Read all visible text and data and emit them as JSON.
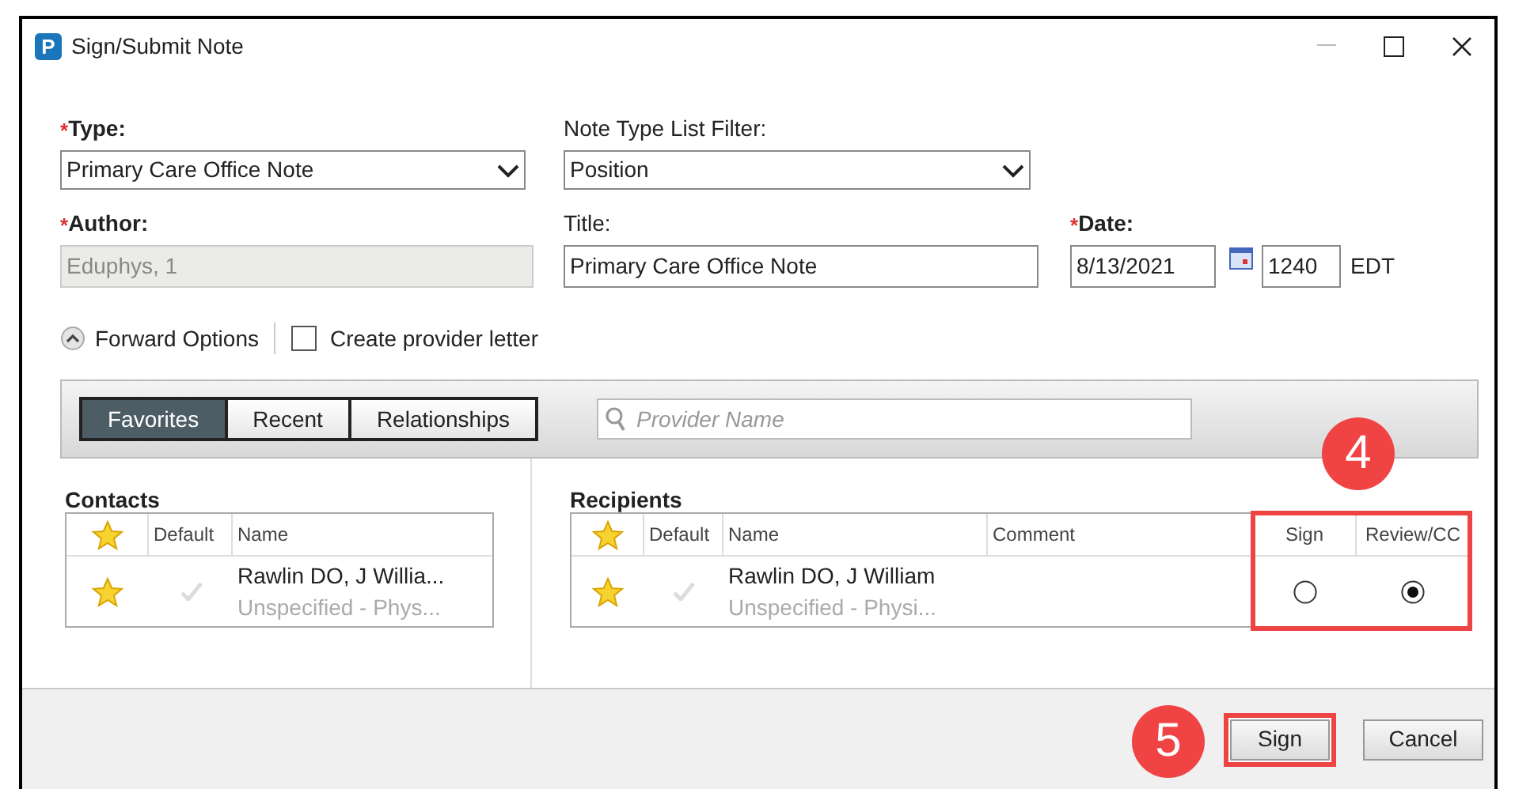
{
  "window": {
    "title": "Sign/Submit Note",
    "app_icon_letter": "P"
  },
  "type": {
    "required_mark": "*",
    "label": "Type:",
    "value": "Primary Care Office Note"
  },
  "note_type_list_filter": {
    "label": "Note Type List Filter:",
    "value": "Position"
  },
  "author": {
    "required_mark": "*",
    "label": "Author:",
    "value": "Eduphys, 1",
    "disabled": true
  },
  "title": {
    "label": "Title:",
    "value": "Primary Care Office Note"
  },
  "date": {
    "required_mark": "*",
    "label": "Date:",
    "value": "8/13/2021",
    "time": "1240",
    "zone": "EDT"
  },
  "forward_options": {
    "label": "Forward Options",
    "expanded": true
  },
  "create_provider_letter": {
    "label": "Create provider letter",
    "checked": false
  },
  "tabs": [
    {
      "label": "Favorites",
      "selected": true
    },
    {
      "label": "Recent",
      "selected": false
    },
    {
      "label": "Relationships",
      "selected": false
    }
  ],
  "search": {
    "placeholder": "Provider Name"
  },
  "contacts": {
    "heading": "Contacts",
    "columns": [
      "Default",
      "Name"
    ],
    "rows": [
      {
        "name": "Rawlin DO, J Willia...",
        "detail": "Unspecified - Phys...",
        "favorite": true,
        "default": false
      }
    ]
  },
  "recipients": {
    "heading": "Recipients",
    "columns": [
      "Default",
      "Name",
      "Comment",
      "Sign",
      "Review/CC"
    ],
    "action_columns_highlighted": true,
    "rows": [
      {
        "name": "Rawlin DO, J William",
        "detail": "Unspecified - Physi...",
        "favorite": true,
        "default": false,
        "sign_selected": false,
        "review_cc_selected": true
      }
    ]
  },
  "buttons": [
    {
      "label": "Sign",
      "highlighted": true
    },
    {
      "label": "Cancel",
      "highlighted": false
    }
  ],
  "callouts": [
    {
      "label": "4"
    },
    {
      "label": "5"
    }
  ]
}
